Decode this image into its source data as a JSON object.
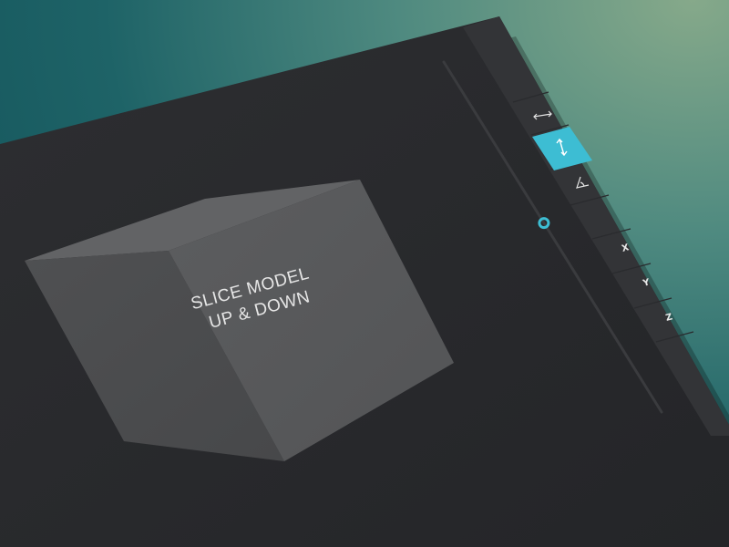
{
  "viewport": {
    "label_line1": "SLICE MODEL",
    "label_line2": "UP & DOWN"
  },
  "toolbar": {
    "tools": [
      {
        "name": "horizontal-move",
        "icon": "arrows-horizontal-icon",
        "active": false
      },
      {
        "name": "vertical-slice",
        "icon": "arrows-vertical-icon",
        "active": true
      },
      {
        "name": "angle",
        "icon": "angle-icon",
        "active": false
      }
    ],
    "axes": [
      {
        "label": "X"
      },
      {
        "label": "Y"
      },
      {
        "label": "Z"
      }
    ]
  },
  "slider": {
    "value": 0.46
  },
  "colors": {
    "accent": "#3dbdd3",
    "panel": "#2b2c2f",
    "sidebar": "#313235",
    "cube_front": "#58595b",
    "cube_side": "#4b4c4e",
    "cube_top": "#5e5f61"
  }
}
